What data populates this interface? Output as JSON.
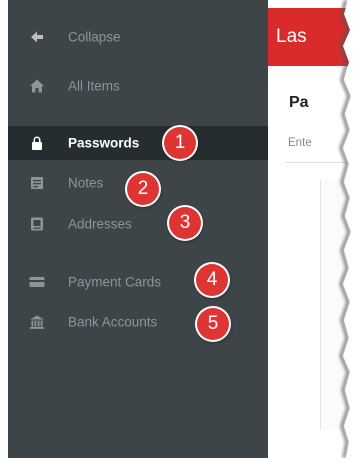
{
  "sidebar": {
    "items": [
      {
        "label": "Collapse",
        "icon": "arrow-left-icon",
        "active": false
      },
      {
        "label": "All Items",
        "icon": "home-icon",
        "active": false
      },
      {
        "label": "Passwords",
        "icon": "lock-icon",
        "active": true
      },
      {
        "label": "Notes",
        "icon": "note-icon",
        "active": false
      },
      {
        "label": "Addresses",
        "icon": "address-card-icon",
        "active": false
      },
      {
        "label": "Payment Cards",
        "icon": "credit-card-icon",
        "active": false
      },
      {
        "label": "Bank Accounts",
        "icon": "bank-icon",
        "active": false
      }
    ]
  },
  "badges": [
    "1",
    "2",
    "3",
    "4",
    "5"
  ],
  "main": {
    "brand": "Las",
    "title": "Pa",
    "search_placeholder": "Ente"
  },
  "colors": {
    "sidebar_bg": "#3d4549",
    "active_bg": "#262d30",
    "accent_red": "#d92b2b",
    "badge_red": "#df3434"
  }
}
